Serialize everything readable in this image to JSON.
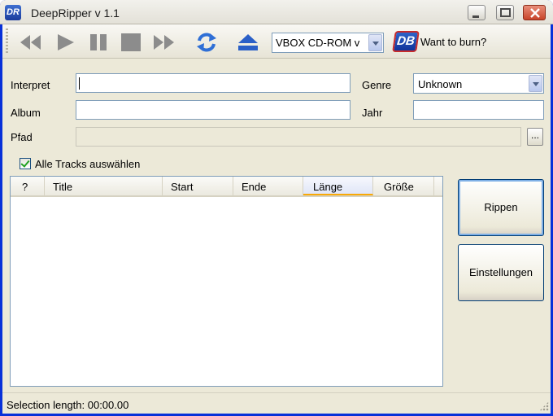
{
  "window": {
    "title": "DeepRipper v 1.1",
    "icon_text": "DR"
  },
  "toolbar": {
    "buttons": [
      "rewind-icon",
      "play-icon",
      "pause-icon",
      "stop-icon",
      "fast-forward-icon",
      "refresh-icon",
      "eject-icon"
    ],
    "device": "VBOX CD-ROM v",
    "burn_logo": "DB",
    "burn_link": "Want to burn?"
  },
  "form": {
    "interpret_label": "Interpret",
    "interpret_value": "",
    "album_label": "Album",
    "album_value": "",
    "path_label": "Pfad",
    "path_value": "",
    "browse_label": "...",
    "genre_label": "Genre",
    "genre_value": "Unknown",
    "year_label": "Jahr",
    "year_value": ""
  },
  "select_all": {
    "label": "Alle Tracks auswählen",
    "checked": true
  },
  "tracklist": {
    "columns": [
      "?",
      "Title",
      "Start",
      "Ende",
      "Länge",
      "Größe"
    ],
    "active_column": "Länge",
    "rows": []
  },
  "actions": {
    "rip": "Rippen",
    "settings": "Einstellungen"
  },
  "status": {
    "text": "Selection length:  00:00.00"
  },
  "colors": {
    "titlebar_accent": "#0831d9",
    "toolbar_icons": "#8c8c8c",
    "refresh_icon": "#2f6fd6",
    "eject_icon": "#2a5fc7"
  }
}
